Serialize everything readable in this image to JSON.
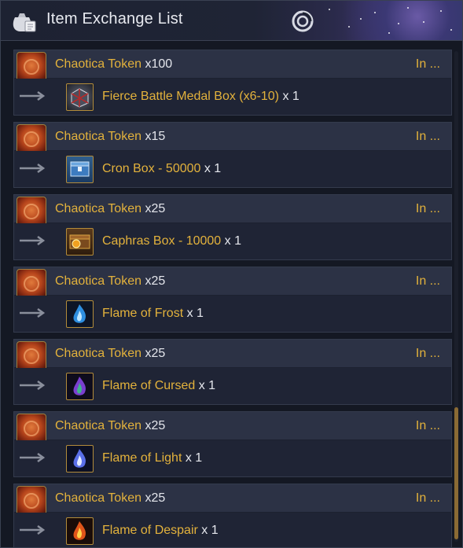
{
  "window": {
    "title": "Item Exchange List",
    "title_icon": "pouch-scroll-icon",
    "accent_color": "#e3b23c"
  },
  "entries": [
    {
      "cost_item": "Chaotica Token",
      "cost_qty": "x100",
      "status": "In ...",
      "reward_item": "Fierce Battle Medal Box (x6-10)",
      "reward_qty": "x 1",
      "reward_icon": "medal-box-icon"
    },
    {
      "cost_item": "Chaotica Token",
      "cost_qty": "x15",
      "status": "In ...",
      "reward_item": "Cron Box - 50000",
      "reward_qty": "x 1",
      "reward_icon": "cron-box-icon"
    },
    {
      "cost_item": "Chaotica Token",
      "cost_qty": "x25",
      "status": "In ...",
      "reward_item": "Caphras Box - 10000",
      "reward_qty": "x 1",
      "reward_icon": "caphras-box-icon"
    },
    {
      "cost_item": "Chaotica Token",
      "cost_qty": "x25",
      "status": "In ...",
      "reward_item": "Flame of Frost",
      "reward_qty": "x 1",
      "reward_icon": "frost-flame-icon"
    },
    {
      "cost_item": "Chaotica Token",
      "cost_qty": "x25",
      "status": "In ...",
      "reward_item": "Flame of Cursed",
      "reward_qty": "x 1",
      "reward_icon": "cursed-flame-icon"
    },
    {
      "cost_item": "Chaotica Token",
      "cost_qty": "x25",
      "status": "In ...",
      "reward_item": "Flame of Light",
      "reward_qty": "x 1",
      "reward_icon": "light-flame-icon"
    },
    {
      "cost_item": "Chaotica Token",
      "cost_qty": "x25",
      "status": "In ...",
      "reward_item": "Flame of Despair",
      "reward_qty": "x 1",
      "reward_icon": "despair-flame-icon"
    }
  ]
}
